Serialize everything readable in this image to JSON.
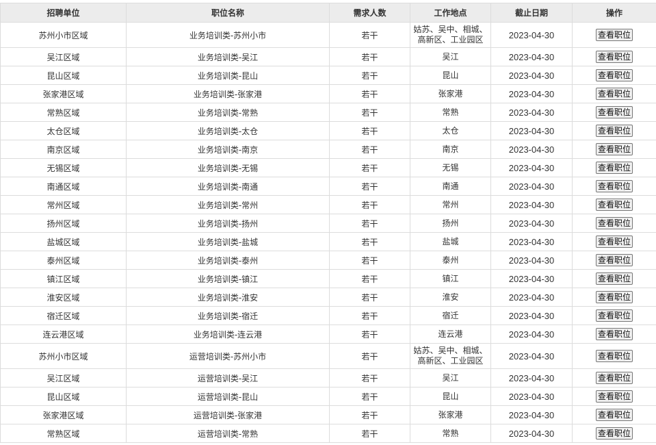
{
  "headers": {
    "unit": "招聘单位",
    "position": "职位名称",
    "count": "需求人数",
    "location": "工作地点",
    "deadline": "截止日期",
    "action": "操作"
  },
  "rows": [
    {
      "unit": "苏州小市区域",
      "position": "业务培训类-苏州小市",
      "count": "若干",
      "loc1": "姑苏、吴中、相城、",
      "loc2": "高新区、工业园区",
      "date": "2023-04-30",
      "btn": "查看职位"
    },
    {
      "unit": "吴江区域",
      "position": "业务培训类-吴江",
      "count": "若干",
      "loc1": "吴江",
      "loc2": "",
      "date": "2023-04-30",
      "btn": "查看职位"
    },
    {
      "unit": "昆山区域",
      "position": "业务培训类-昆山",
      "count": "若干",
      "loc1": "昆山",
      "loc2": "",
      "date": "2023-04-30",
      "btn": "查看职位"
    },
    {
      "unit": "张家港区域",
      "position": "业务培训类-张家港",
      "count": "若干",
      "loc1": "张家港",
      "loc2": "",
      "date": "2023-04-30",
      "btn": "查看职位"
    },
    {
      "unit": "常熟区域",
      "position": "业务培训类-常熟",
      "count": "若干",
      "loc1": "常熟",
      "loc2": "",
      "date": "2023-04-30",
      "btn": "查看职位"
    },
    {
      "unit": "太仓区域",
      "position": "业务培训类-太仓",
      "count": "若干",
      "loc1": "太仓",
      "loc2": "",
      "date": "2023-04-30",
      "btn": "查看职位"
    },
    {
      "unit": "南京区域",
      "position": "业务培训类-南京",
      "count": "若干",
      "loc1": "南京",
      "loc2": "",
      "date": "2023-04-30",
      "btn": "查看职位"
    },
    {
      "unit": "无锡区域",
      "position": "业务培训类-无锡",
      "count": "若干",
      "loc1": "无锡",
      "loc2": "",
      "date": "2023-04-30",
      "btn": "查看职位"
    },
    {
      "unit": "南通区域",
      "position": "业务培训类-南通",
      "count": "若干",
      "loc1": "南通",
      "loc2": "",
      "date": "2023-04-30",
      "btn": "查看职位"
    },
    {
      "unit": "常州区域",
      "position": "业务培训类-常州",
      "count": "若干",
      "loc1": "常州",
      "loc2": "",
      "date": "2023-04-30",
      "btn": "查看职位"
    },
    {
      "unit": "扬州区域",
      "position": "业务培训类-扬州",
      "count": "若干",
      "loc1": "扬州",
      "loc2": "",
      "date": "2023-04-30",
      "btn": "查看职位"
    },
    {
      "unit": "盐城区域",
      "position": "业务培训类-盐城",
      "count": "若干",
      "loc1": "盐城",
      "loc2": "",
      "date": "2023-04-30",
      "btn": "查看职位"
    },
    {
      "unit": "泰州区域",
      "position": "业务培训类-泰州",
      "count": "若干",
      "loc1": "泰州",
      "loc2": "",
      "date": "2023-04-30",
      "btn": "查看职位"
    },
    {
      "unit": "镇江区域",
      "position": "业务培训类-镇江",
      "count": "若干",
      "loc1": "镇江",
      "loc2": "",
      "date": "2023-04-30",
      "btn": "查看职位"
    },
    {
      "unit": "淮安区域",
      "position": "业务培训类-淮安",
      "count": "若干",
      "loc1": "淮安",
      "loc2": "",
      "date": "2023-04-30",
      "btn": "查看职位"
    },
    {
      "unit": "宿迁区域",
      "position": "业务培训类-宿迁",
      "count": "若干",
      "loc1": "宿迁",
      "loc2": "",
      "date": "2023-04-30",
      "btn": "查看职位"
    },
    {
      "unit": "连云港区域",
      "position": "业务培训类-连云港",
      "count": "若干",
      "loc1": "连云港",
      "loc2": "",
      "date": "2023-04-30",
      "btn": "查看职位"
    },
    {
      "unit": "苏州小市区域",
      "position": "运营培训类-苏州小市",
      "count": "若干",
      "loc1": "姑苏、吴中、相城、",
      "loc2": "高新区、工业园区",
      "date": "2023-04-30",
      "btn": "查看职位"
    },
    {
      "unit": "吴江区域",
      "position": "运营培训类-吴江",
      "count": "若干",
      "loc1": "吴江",
      "loc2": "",
      "date": "2023-04-30",
      "btn": "查看职位"
    },
    {
      "unit": "昆山区域",
      "position": "运营培训类-昆山",
      "count": "若干",
      "loc1": "昆山",
      "loc2": "",
      "date": "2023-04-30",
      "btn": "查看职位"
    },
    {
      "unit": "张家港区域",
      "position": "运营培训类-张家港",
      "count": "若干",
      "loc1": "张家港",
      "loc2": "",
      "date": "2023-04-30",
      "btn": "查看职位"
    },
    {
      "unit": "常熟区域",
      "position": "运营培训类-常熟",
      "count": "若干",
      "loc1": "常熟",
      "loc2": "",
      "date": "2023-04-30",
      "btn": "查看职位"
    }
  ]
}
